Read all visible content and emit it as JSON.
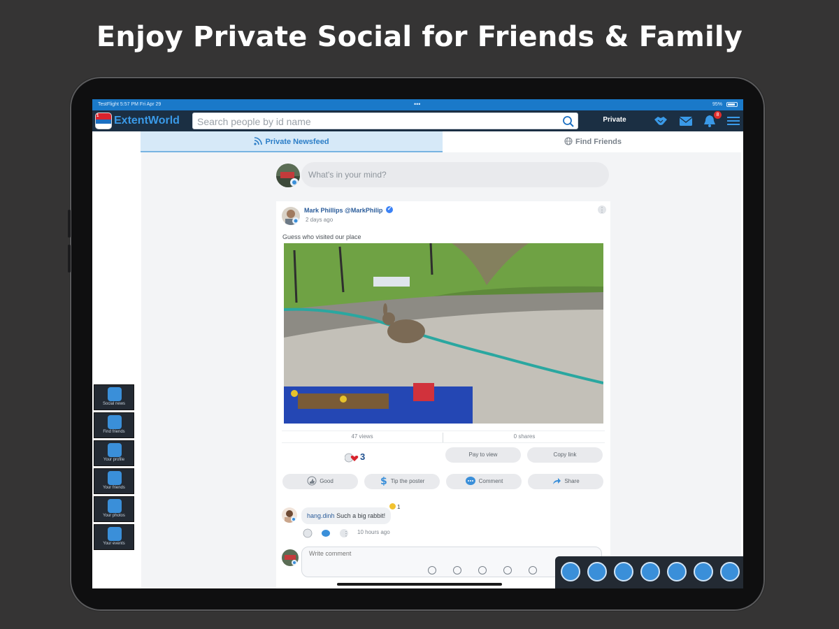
{
  "headline": "Enjoy Private Social for Friends & Family",
  "status_bar": {
    "left": "TestFlight  5:57 PM  Fri Apr 29",
    "dots": "•••",
    "right": "95%"
  },
  "header": {
    "logo_badge": "1",
    "app_name": "ExtentWorld",
    "search_placeholder": "Search people by id name",
    "mode_label": "Private",
    "notification_count": "8",
    "icons": [
      "handshake-icon",
      "mail-icon",
      "bell-icon",
      "menu-icon"
    ]
  },
  "tabs": [
    {
      "label": "Private Newsfeed",
      "icon": "rss-icon",
      "active": true
    },
    {
      "label": "Find Friends",
      "icon": "globe-icon",
      "active": false
    }
  ],
  "composer": {
    "placeholder": "What's in your mind?"
  },
  "post": {
    "author": "Mark Phillips",
    "handle": "@MarkPhilip",
    "time": "2 days ago",
    "caption": "Guess who visited our place",
    "views": "47 views",
    "shares": "0 shares",
    "reaction_count": "3",
    "pay_to_view": "Pay to view",
    "copy_link": "Copy link",
    "actions": [
      "Good",
      "Tip the poster",
      "Comment",
      "Share"
    ]
  },
  "comment": {
    "user": "hang.dinh",
    "text": "Such a big rabbit!",
    "reaction_count": "1",
    "time": "10 hours ago",
    "write_placeholder": "Write comment"
  },
  "side_menu": [
    {
      "label": "Social news",
      "icon": "rss-icon"
    },
    {
      "label": "Find friends",
      "icon": "globe-icon"
    },
    {
      "label": "Your profile",
      "icon": "home-icon"
    },
    {
      "label": "Your friends",
      "icon": "handshake-icon"
    },
    {
      "label": "Your photos",
      "icon": "photo-icon"
    },
    {
      "label": "Your events",
      "icon": "calendar-icon"
    }
  ],
  "dock_icons": [
    "newsfeed-icon",
    "profile-icon",
    "messenger-icon",
    "chat-icon",
    "video-call-icon",
    "group-icon",
    "bookmark-icon"
  ],
  "colors": {
    "brand_blue": "#1a79c9",
    "navbar": "#1b2f43",
    "accent": "#3a9ae8",
    "background": "#353434"
  }
}
